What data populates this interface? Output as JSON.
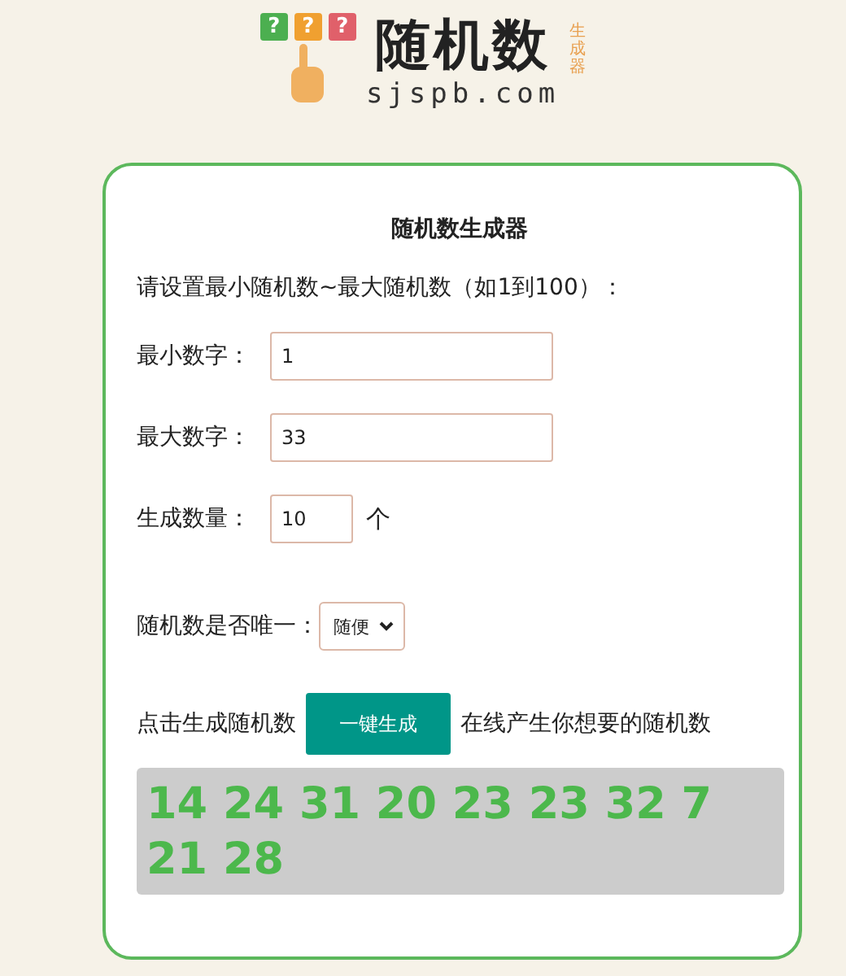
{
  "logo": {
    "marks": [
      {
        "text": "?",
        "color": "#4caf50"
      },
      {
        "text": "?",
        "color": "#f0a030"
      },
      {
        "text": "?",
        "color": "#e0606a"
      }
    ],
    "title": "随机数",
    "domain": "sjspb.com",
    "tag": "生成器"
  },
  "card": {
    "title": "随机数生成器",
    "instruction": "请设置最小随机数~最大随机数（如1到100）：",
    "fields": [
      {
        "label": "最小数字：",
        "value": "1",
        "kind": "wide"
      },
      {
        "label": "最大数字：",
        "value": "33",
        "kind": "wide"
      },
      {
        "label": "生成数量：",
        "value": "10",
        "kind": "short",
        "unit": "个"
      }
    ],
    "unique": {
      "label": "随机数是否唯一：",
      "value": "随便"
    },
    "action": {
      "before": "点击生成随机数",
      "button": "一键生成",
      "after": "在线产生你想要的随机数"
    },
    "result": "14 24 31 20 23 23 32 7 21 28"
  }
}
